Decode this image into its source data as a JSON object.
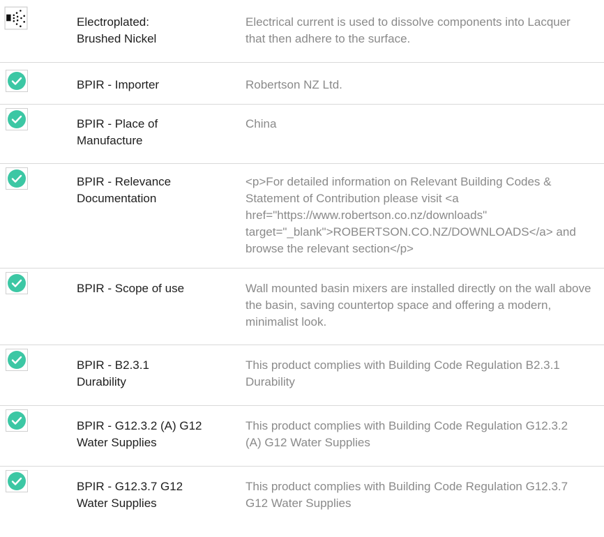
{
  "colors": {
    "check_badge": "#3cc7a4",
    "label_text": "#1e1e1e",
    "value_text": "#8a8a8a",
    "divider": "#d9d9d9"
  },
  "rows": [
    {
      "icon": "spray-finish-icon",
      "label": "Electroplated: Brushed Nickel",
      "value": "Electrical current is used to dissolve components into Lacquer that then adhere to the surface."
    },
    {
      "icon": "check-circle-icon",
      "label": "BPIR - Importer",
      "value": "Robertson NZ Ltd."
    },
    {
      "icon": "check-circle-icon",
      "label": "BPIR - Place of Manufacture",
      "value": "China"
    },
    {
      "icon": "check-circle-icon",
      "label": "BPIR - Relevance Documentation",
      "value": "<p>For detailed information on Relevant Building Codes & Statement of Contribution please visit <a href=\"https://www.robertson.co.nz/downloads\" target=\"_blank\">ROBERTSON.CO.NZ/DOWNLOADS</a> and browse the relevant section</p>"
    },
    {
      "icon": "check-circle-icon",
      "label": "BPIR - Scope of use",
      "value": "Wall mounted basin mixers are installed directly on the wall above the basin, saving countertop space and offering a modern, minimalist look."
    },
    {
      "icon": "check-circle-icon",
      "label": "BPIR - B2.3.1 Durability",
      "value": "This product complies with Building Code Regulation B2.3.1 Durability"
    },
    {
      "icon": "check-circle-icon",
      "label": "BPIR - G12.3.2 (A) G12 Water Supplies",
      "value": "This product complies with Building Code Regulation G12.3.2 (A) G12 Water Supplies"
    },
    {
      "icon": "check-circle-icon",
      "label": "BPIR - G12.3.7 G12 Water Supplies",
      "value": "This product complies with Building Code Regulation G12.3.7 G12 Water Supplies"
    }
  ]
}
